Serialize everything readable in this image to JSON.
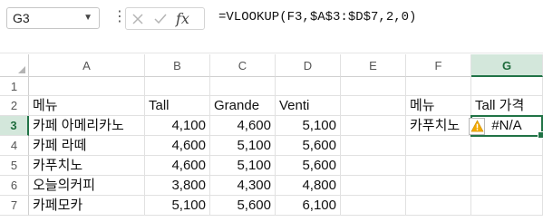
{
  "name_box": {
    "value": "G3"
  },
  "formula_bar": {
    "fx_label": "fx",
    "formula": "=VLOOKUP(F3,$A$3:$D$7,2,0)"
  },
  "columns": [
    "A",
    "B",
    "C",
    "D",
    "E",
    "F",
    "G"
  ],
  "rows": [
    "1",
    "2",
    "3",
    "4",
    "5",
    "6",
    "7"
  ],
  "selected": {
    "column": "G",
    "row": "3"
  },
  "table": {
    "headers": [
      "메뉴",
      "Tall",
      "Grande",
      "Venti"
    ],
    "rows": [
      [
        "카페 아메리카노",
        "4,100",
        "4,600",
        "5,100"
      ],
      [
        "카페 라떼",
        "4,600",
        "5,100",
        "5,600"
      ],
      [
        "카푸치노",
        "4,600",
        "5,100",
        "5,600"
      ],
      [
        "오늘의커피",
        "3,800",
        "4,300",
        "4,800"
      ],
      [
        "카페모카",
        "5,100",
        "5,600",
        "6,100"
      ]
    ]
  },
  "lookup": {
    "menu_header": "메뉴",
    "price_header": "Tall 가격",
    "menu_value": "카푸치노",
    "result_value": "#N/A"
  },
  "icons": {
    "error_warning": "warning-icon",
    "cancel": "close-icon",
    "enter": "check-icon",
    "insert_function": "fx-icon"
  },
  "colors": {
    "accent": "#217346",
    "header_selected_bg": "#d3e7db",
    "warning": "#f2a900"
  }
}
